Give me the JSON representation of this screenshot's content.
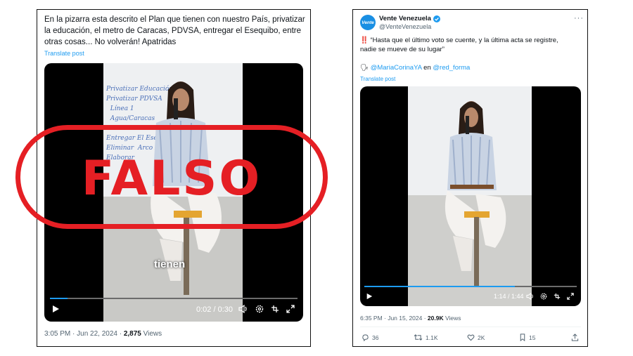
{
  "left_tweet": {
    "text_line1": "En la pizarra esta descrito el Plan que tienen con nuestro País, privatizar",
    "text_line2": "la educación, el metro de Caracas, PDVSA, entregar el Esequibo,  entre",
    "text_line3": "otras cosas... No volverán! Apatridas",
    "translate_label": "Translate post",
    "video": {
      "caption": "tienen",
      "time": "0:02 / 0:30",
      "progress": 0.07
    },
    "timestamp": "3:05 PM · Jun 22, 2024 · ",
    "views_count": "2,875",
    "views_label": " Views"
  },
  "stamp": {
    "text": "FALSO",
    "color": "#e51f24"
  },
  "right_tweet": {
    "avatar_text": "Vente",
    "display_name": "Vente Venezuela",
    "handle": "@VenteVenezuela",
    "more_label": "···",
    "text_emoji": "‼️",
    "text_line1": "“Hasta que el último voto se cuente, y la última acta se registre,",
    "text_line2": "nadie se mueve de su lugar”",
    "speaker_emoji": "🗣",
    "mention1": "@MariaCorinaYA",
    "mention_joiner": " en ",
    "mention2": "@red_forma",
    "translate_label": "Translate post",
    "video": {
      "time": "1:14 / 1:44",
      "progress": 0.71
    },
    "timestamp": "6:35 PM · Jun 15, 2024 · ",
    "views_count": "20.9K",
    "views_label": " Views",
    "actions": {
      "replies": "36",
      "reposts": "1.1K",
      "likes": "2K",
      "bookmarks": "15"
    }
  },
  "colors": {
    "accent": "#1d9bf0",
    "verified": "#1d9bf0",
    "stamp": "#e51f24"
  }
}
